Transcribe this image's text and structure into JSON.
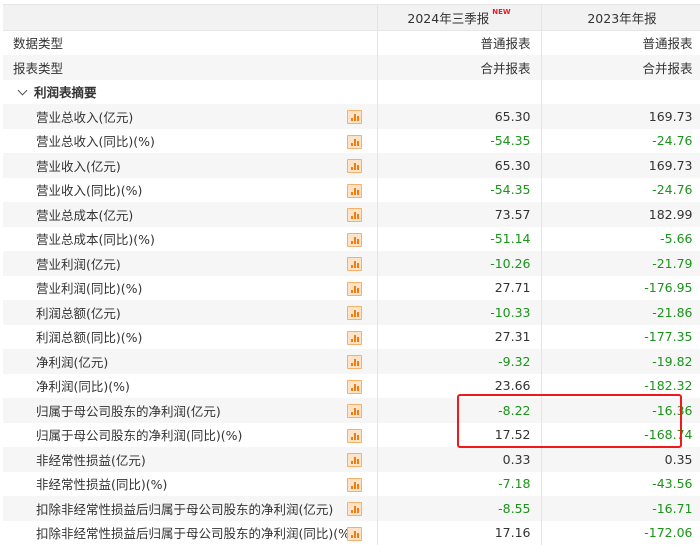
{
  "header": {
    "col1": "",
    "col2": "2024年三季报",
    "col2_badge": "NEW",
    "col3": "2023年年报"
  },
  "meta_rows": [
    {
      "label": "数据类型",
      "v1": "普通报表",
      "v2": "普通报表"
    },
    {
      "label": "报表类型",
      "v1": "合并报表",
      "v2": "合并报表"
    }
  ],
  "section": {
    "title": "利润表摘要"
  },
  "rows": [
    {
      "label": "营业总收入(亿元)",
      "v1": "65.30",
      "v2": "169.73"
    },
    {
      "label": "营业总收入(同比)(%)",
      "v1": "-54.35",
      "v2": "-24.76"
    },
    {
      "label": "营业收入(亿元)",
      "v1": "65.30",
      "v2": "169.73"
    },
    {
      "label": "营业收入(同比)(%)",
      "v1": "-54.35",
      "v2": "-24.76"
    },
    {
      "label": "营业总成本(亿元)",
      "v1": "73.57",
      "v2": "182.99"
    },
    {
      "label": "营业总成本(同比)(%)",
      "v1": "-51.14",
      "v2": "-5.66"
    },
    {
      "label": "营业利润(亿元)",
      "v1": "-10.26",
      "v2": "-21.79"
    },
    {
      "label": "营业利润(同比)(%)",
      "v1": "27.71",
      "v2": "-176.95"
    },
    {
      "label": "利润总额(亿元)",
      "v1": "-10.33",
      "v2": "-21.86"
    },
    {
      "label": "利润总额(同比)(%)",
      "v1": "27.31",
      "v2": "-177.35"
    },
    {
      "label": "净利润(亿元)",
      "v1": "-9.32",
      "v2": "-19.82"
    },
    {
      "label": "净利润(同比)(%)",
      "v1": "23.66",
      "v2": "-182.32"
    },
    {
      "label": "归属于母公司股东的净利润(亿元)",
      "v1": "-8.22",
      "v2": "-16.36"
    },
    {
      "label": "归属于母公司股东的净利润(同比)(%)",
      "v1": "17.52",
      "v2": "-168.74"
    },
    {
      "label": "非经常性损益(亿元)",
      "v1": "0.33",
      "v2": "0.35"
    },
    {
      "label": "非经常性损益(同比)(%)",
      "v1": "-7.18",
      "v2": "-43.56"
    },
    {
      "label": "扣除非经常性损益后归属于母公司股东的净利润(亿元)",
      "v1": "-8.55",
      "v2": "-16.71"
    },
    {
      "label": "扣除非经常性损益后归属于母公司股东的净利润(同比)(%)",
      "v1": "17.16",
      "v2": "-172.06"
    }
  ],
  "colors": {
    "negative": "#1a951a",
    "highlight": "#f01818",
    "icon": "#f27b14"
  }
}
